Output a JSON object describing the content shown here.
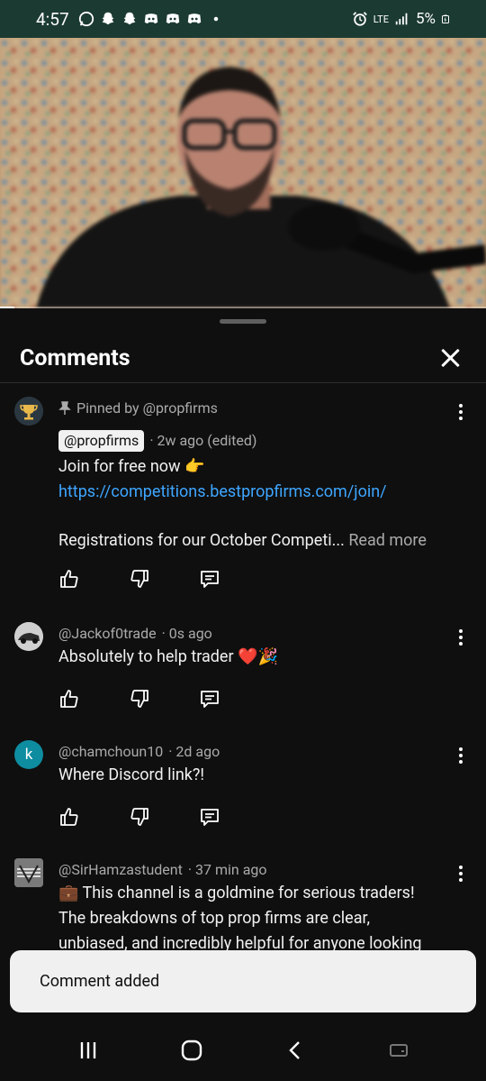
{
  "status_bar": {
    "time": "4:57",
    "network": "LTE",
    "battery": "5%",
    "icons_left": [
      "whatsapp-icon",
      "snapchat-icon",
      "snapchat-icon",
      "discord-icon",
      "discord-icon",
      "discord-icon",
      "dot-icon"
    ],
    "icons_right": [
      "alarm-icon",
      "lte-icon",
      "signal-icon",
      "battery-icon"
    ]
  },
  "video": {
    "progress_fraction": 0.03
  },
  "sheet": {
    "title": "Comments"
  },
  "comments": [
    {
      "pinned_label": "Pinned by @propfirms",
      "author": "@propfirms",
      "time": "· 2w ago (edited)",
      "line1": "Join for free now 👉",
      "link": "https://competitions.bestpropfirms.com/join/",
      "line3": "Registrations for our October Competi...",
      "read_more": "Read more",
      "avatar_icon": "trophy-icon"
    },
    {
      "author": "@Jackof0trade",
      "time": "· 0s ago",
      "text": "Absolutely to help trader ❤️🎉",
      "avatar_icon": "car-avatar"
    },
    {
      "author": "@chamchoun10",
      "time": "· 2d ago",
      "text": "Where Discord link?!",
      "avatar_letter": "k",
      "avatar_color": "#0e8ca0"
    },
    {
      "author": "@SirHamzastudent",
      "time": "· 37 min ago",
      "text": "💼 This channel is a goldmine for serious traders! The breakdowns of top prop firms are clear, unbiased, and incredibly helpful for anyone looking",
      "avatar_icon": "logo-avatar"
    }
  ],
  "snackbar": {
    "message": "Comment added"
  },
  "colors": {
    "background": "#0f0f0f",
    "link": "#3ea6ff",
    "meta": "#aaaaaa",
    "status_bar": "#1b3a32"
  }
}
